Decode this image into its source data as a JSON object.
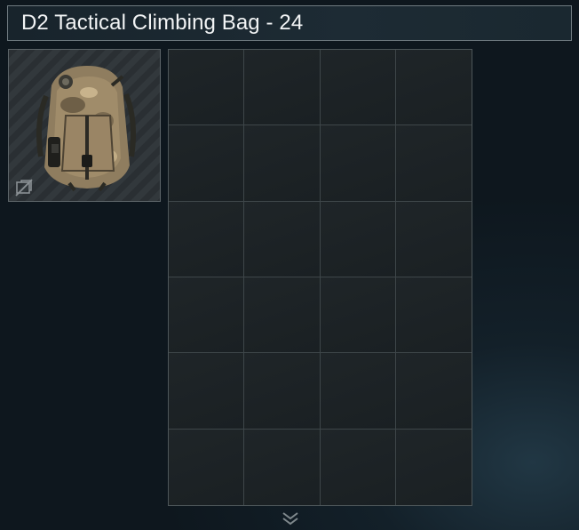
{
  "window": {
    "title": "D2 Tactical Climbing Bag - 24"
  },
  "item": {
    "icon": "backpack-image",
    "status_icon": "no-insurance-icon"
  },
  "grid": {
    "columns": 4,
    "rows": 6
  },
  "footer": {
    "icon": "double-chevron-down-icon"
  }
}
